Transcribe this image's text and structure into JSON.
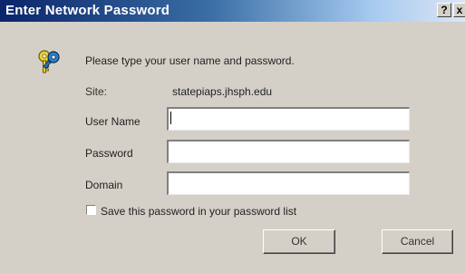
{
  "window": {
    "title": "Enter Network Password",
    "help_label": "?",
    "close_label": "x"
  },
  "icon": "keys-icon",
  "prompt": "Please type your user name and password.",
  "site": {
    "label": "Site:",
    "value": "statepiaps.jhsph.edu"
  },
  "fields": {
    "username": {
      "label": "User Name",
      "value": ""
    },
    "password": {
      "label": "Password",
      "value": ""
    },
    "domain": {
      "label": "Domain",
      "value": ""
    }
  },
  "save_checkbox": {
    "label": "Save this password in your password list",
    "checked": false
  },
  "buttons": {
    "ok": "OK",
    "cancel": "Cancel"
  },
  "colors": {
    "titlebar_start": "#0a246a",
    "titlebar_end": "#dbe6f3",
    "dialog_bg": "#d4d0c8"
  }
}
